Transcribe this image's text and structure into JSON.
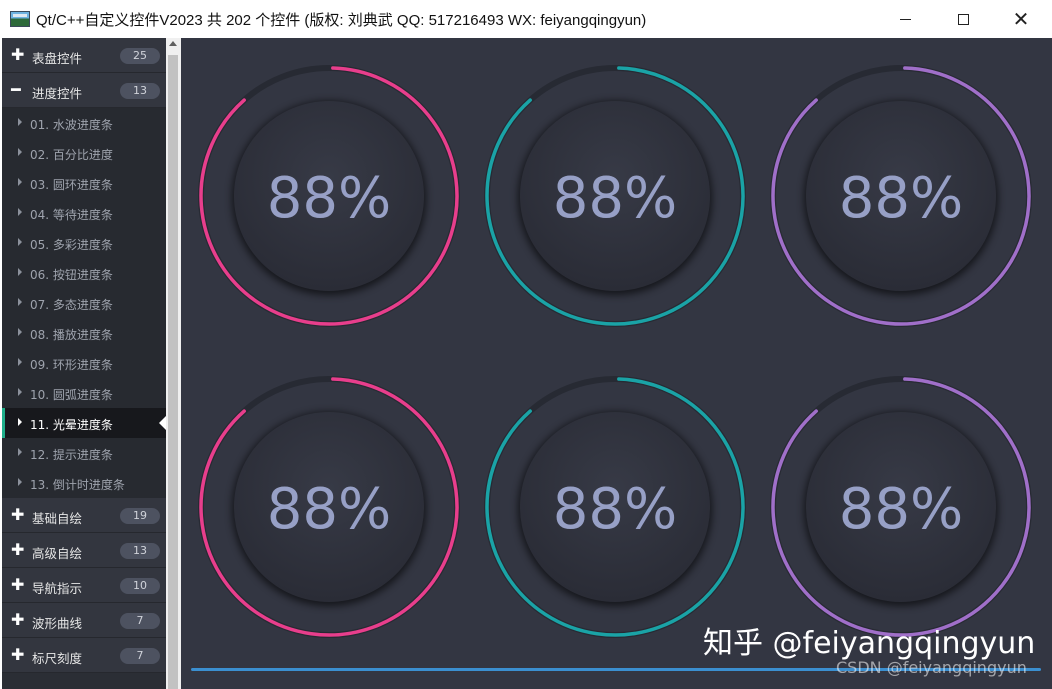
{
  "window": {
    "title": "Qt/C++自定义控件V2023 共 202 个控件 (版权: 刘典武 QQ: 517216493 WX: feiyangqingyun)",
    "min_glyph": "—",
    "close_glyph": "✕"
  },
  "sidebar": {
    "groups_top": [
      {
        "label": "表盘控件",
        "count": "25",
        "expanded": false
      },
      {
        "label": "进度控件",
        "count": "13",
        "expanded": true
      }
    ],
    "items": [
      {
        "label": "01. 水波进度条"
      },
      {
        "label": "02. 百分比进度"
      },
      {
        "label": "03. 圆环进度条"
      },
      {
        "label": "04. 等待进度条"
      },
      {
        "label": "05. 多彩进度条"
      },
      {
        "label": "06. 按钮进度条"
      },
      {
        "label": "07. 多态进度条"
      },
      {
        "label": "08. 播放进度条"
      },
      {
        "label": "09. 环形进度条"
      },
      {
        "label": "10. 圆弧进度条"
      },
      {
        "label": "11. 光晕进度条",
        "active": true
      },
      {
        "label": "12. 提示进度条"
      },
      {
        "label": "13. 倒计时进度条"
      }
    ],
    "groups_bottom": [
      {
        "label": "基础自绘",
        "count": "19"
      },
      {
        "label": "高级自绘",
        "count": "13"
      },
      {
        "label": "导航指示",
        "count": "10"
      },
      {
        "label": "波形曲线",
        "count": "7"
      },
      {
        "label": "标尺刻度",
        "count": "7"
      }
    ],
    "plus_glyph": "✚",
    "minus_glyph": "━"
  },
  "gauges": [
    {
      "text": "88%",
      "value": 88,
      "color": "#e83e8c"
    },
    {
      "text": "88%",
      "value": 88,
      "color": "#1aa3a6"
    },
    {
      "text": "88%",
      "value": 88,
      "color": "#a06fc9"
    },
    {
      "text": "88%",
      "value": 88,
      "color": "#e83e8c"
    },
    {
      "text": "88%",
      "value": 88,
      "color": "#1aa3a6"
    },
    {
      "text": "88%",
      "value": 88,
      "color": "#a06fc9"
    }
  ],
  "colors": {
    "background": "#333642",
    "track": "#272a33",
    "percent_text": "#97a0c6"
  },
  "watermark": {
    "main": "知乎 @feiyangqingyun",
    "sub": "CSDN @feiyangqingyun"
  }
}
